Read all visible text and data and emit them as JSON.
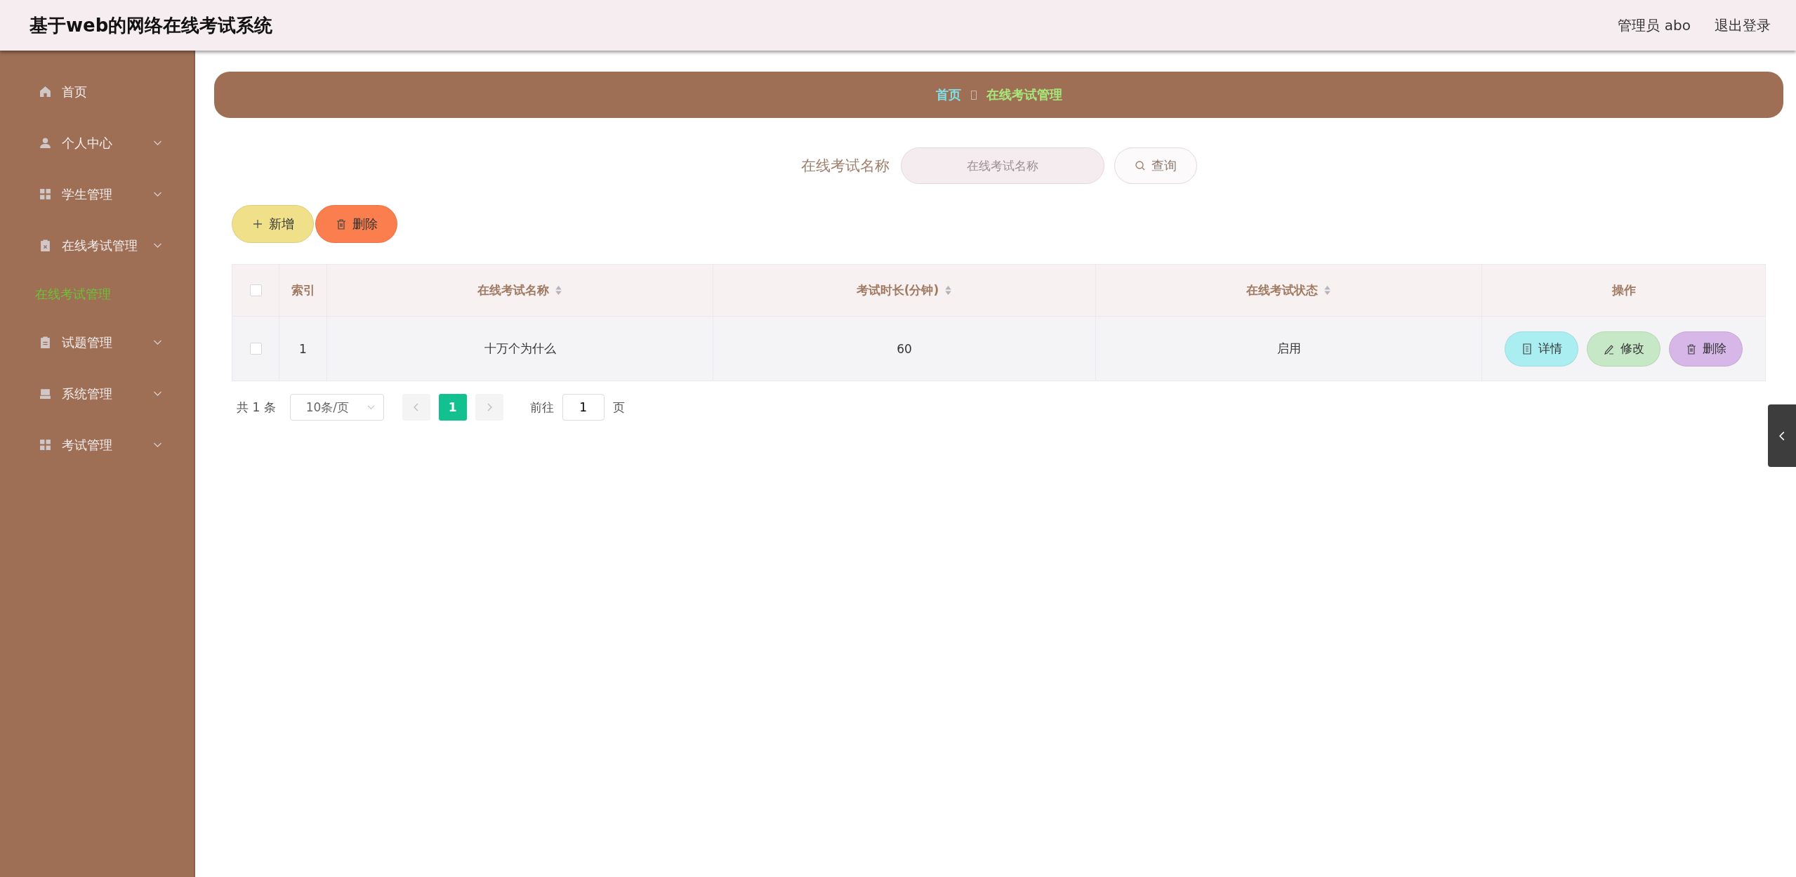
{
  "header": {
    "title": "基于web的网络在线考试系统",
    "user": "管理员 abo",
    "logout": "退出登录"
  },
  "sidebar": {
    "items": [
      {
        "label": "首页",
        "kind": "link"
      },
      {
        "label": "个人中心",
        "kind": "submenu"
      },
      {
        "label": "学生管理",
        "kind": "submenu"
      },
      {
        "label": "在线考试管理",
        "kind": "submenu",
        "children": [
          {
            "label": "在线考试管理",
            "selected": true
          }
        ]
      },
      {
        "label": "试题管理",
        "kind": "submenu"
      },
      {
        "label": "系统管理",
        "kind": "submenu"
      },
      {
        "label": "考试管理",
        "kind": "submenu"
      }
    ]
  },
  "breadcrumb": [
    {
      "label": "首页",
      "color": "#7fe0e8"
    },
    {
      "label": "在线考试管理",
      "color": "#a6e87a"
    }
  ],
  "search": {
    "label": "在线考试名称",
    "placeholder": "在线考试名称",
    "button": "查询"
  },
  "actions": [
    {
      "label": "新增",
      "kind": "add"
    },
    {
      "label": "删除",
      "kind": "delete"
    }
  ],
  "table": {
    "all_checked": false,
    "columns": [
      {
        "label": "索引",
        "sortable": false
      },
      {
        "label": "在线考试名称",
        "sortable": true
      },
      {
        "label": "考试时长(分钟)",
        "sortable": true
      },
      {
        "label": "在线考试状态",
        "sortable": true
      },
      {
        "label": "操作",
        "sortable": false
      }
    ],
    "rows": [
      {
        "checked": false,
        "cells": [
          "1",
          "十万个为什么",
          "60",
          "启用"
        ],
        "actions": [
          {
            "label": "详情",
            "kind": "detail"
          },
          {
            "label": "修改",
            "kind": "edit"
          },
          {
            "label": "删除",
            "kind": "delete"
          }
        ]
      }
    ]
  },
  "pagination": {
    "total": "共 1 条",
    "page_size": "10条/页",
    "pages": [
      {
        "label": "1",
        "selected": true
      }
    ],
    "goto_label": "前往",
    "goto_value": "1",
    "goto_suffix": "页"
  }
}
